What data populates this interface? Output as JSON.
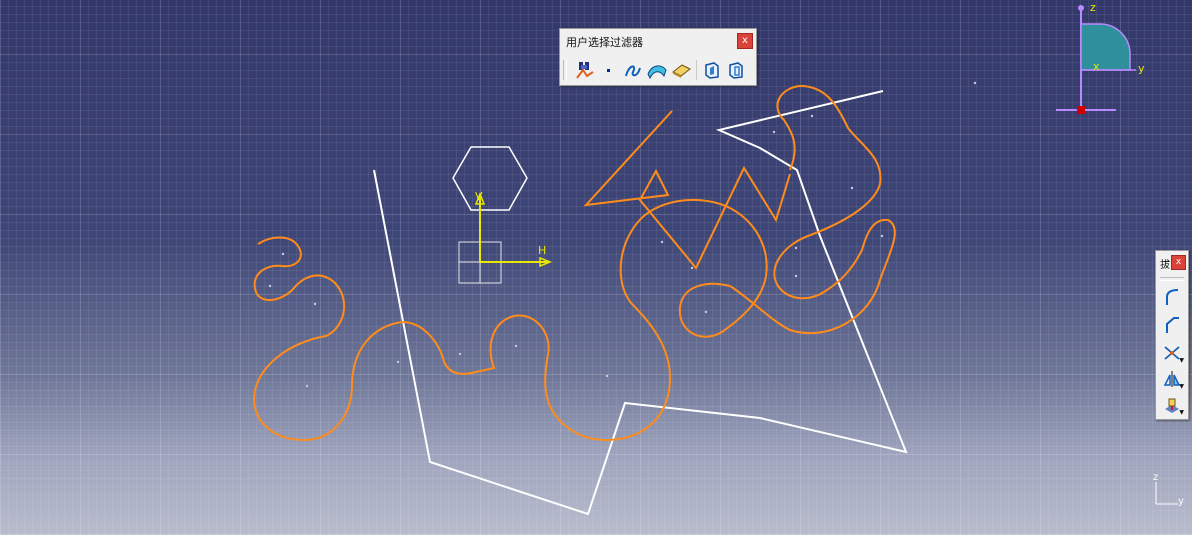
{
  "filter_toolbar": {
    "title": "用户选择过滤器",
    "close_label": "x",
    "buttons": [
      {
        "name": "select-filter-button",
        "icon": "filter-icon"
      },
      {
        "name": "point-filter-button",
        "icon": "point-icon"
      },
      {
        "name": "curve-filter-button",
        "icon": "curve-icon"
      },
      {
        "name": "surface-filter-button",
        "icon": "surface-icon"
      },
      {
        "name": "volume-filter-button",
        "icon": "volume-icon"
      },
      {
        "name": "feature-element-filter-button",
        "icon": "feature-element-icon"
      },
      {
        "name": "geometry-element-filter-button",
        "icon": "geometry-element-icon"
      }
    ]
  },
  "side_toolbar": {
    "title": "拔",
    "close_label": "x"
  },
  "sketch_axes": {
    "h_label": "H",
    "v_label": "V"
  },
  "compass": {
    "z_label": "z",
    "y_label": "y",
    "x_label": "x"
  },
  "mini_axis": {
    "z_label": "z",
    "y_label": "y"
  },
  "colors": {
    "curve": "#ff8c1a",
    "line": "#ffffff",
    "axis": "#e8e800",
    "compass_fill": "#2f8f9a",
    "compass_axis": "#b88aff",
    "background_top": "#33386a",
    "background_bottom": "#b8bccd"
  }
}
